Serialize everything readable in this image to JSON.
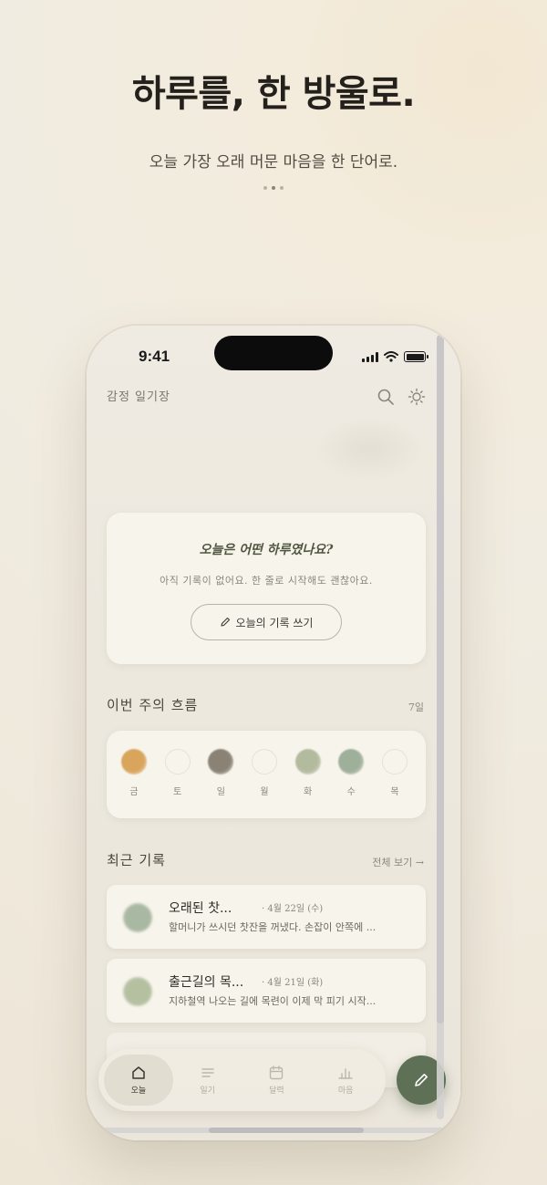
{
  "hero": {
    "title": "하루를, 한 방울로.",
    "subtitle": "오늘 가장 오래 머문 마음을 한 단어로."
  },
  "status_bar": {
    "time": "9:41"
  },
  "app": {
    "name": "감정 일기장"
  },
  "today_card": {
    "question": "오늘은 어떤 하루였나요?",
    "message": "아직 기록이 없어요. 한 줄로 시작해도 괜찮아요.",
    "button_label": "오늘의 기록 쓰기"
  },
  "week": {
    "title": "이번 주의 흐름",
    "meta": "7일",
    "days": [
      {
        "label": "금",
        "color": "#d9a55c"
      },
      {
        "label": "토",
        "color": ""
      },
      {
        "label": "일",
        "color": "#8b8276"
      },
      {
        "label": "월",
        "color": ""
      },
      {
        "label": "화",
        "color": "#b3bb9f"
      },
      {
        "label": "수",
        "color": "#9fb09a"
      },
      {
        "label": "목",
        "color": ""
      }
    ]
  },
  "recent": {
    "title": "최근 기록",
    "view_all": "전체 보기 →",
    "entries": [
      {
        "title": "오래된 찻...",
        "date": "· 4월 22일 (수)",
        "preview": "할머니가 쓰시던 찻잔을 꺼냈다. 손잡이 안쪽에 ...",
        "color": "#a9b8a2"
      },
      {
        "title": "출근길의 목...",
        "date": "· 4월 21일 (화)",
        "preview": "지하철역 나오는 길에 목련이 이제 막 피기 시작...",
        "color": "#b5c0a1"
      }
    ]
  },
  "tabs": [
    {
      "label": "오늘",
      "icon": "home-icon",
      "active": true
    },
    {
      "label": "일기",
      "icon": "list-icon",
      "active": false
    },
    {
      "label": "달력",
      "icon": "calendar-icon",
      "active": false
    },
    {
      "label": "마음",
      "icon": "chart-icon",
      "active": false
    }
  ],
  "colors": {
    "accent": "#5e7157",
    "card": "#f7f4ec",
    "background": "#efebe2"
  }
}
